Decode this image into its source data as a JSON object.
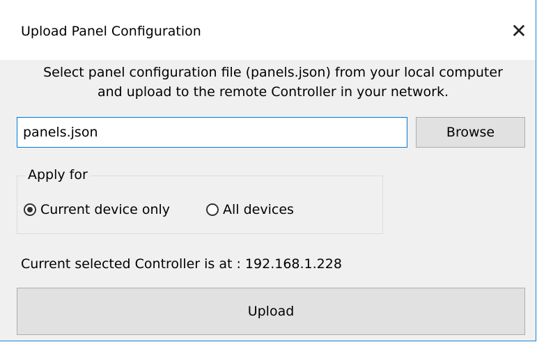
{
  "dialog": {
    "title": "Upload Panel Configuration",
    "close_icon": "close-icon"
  },
  "description": {
    "line1": "Select panel configuration file (panels.json) from your local computer",
    "line2": "and upload to the remote Controller in your network."
  },
  "file": {
    "value": "panels.json",
    "browse_label": "Browse"
  },
  "apply_for": {
    "legend": "Apply for",
    "options": [
      {
        "label": "Current device only",
        "checked": true
      },
      {
        "label": "All devices",
        "checked": false
      }
    ]
  },
  "status_text": "Current selected Controller is at : 192.168.1.228",
  "upload_label": "Upload",
  "colors": {
    "accent": "#0078d7",
    "window_bg": "#f0f0f0",
    "button_bg": "#e1e1e1"
  }
}
